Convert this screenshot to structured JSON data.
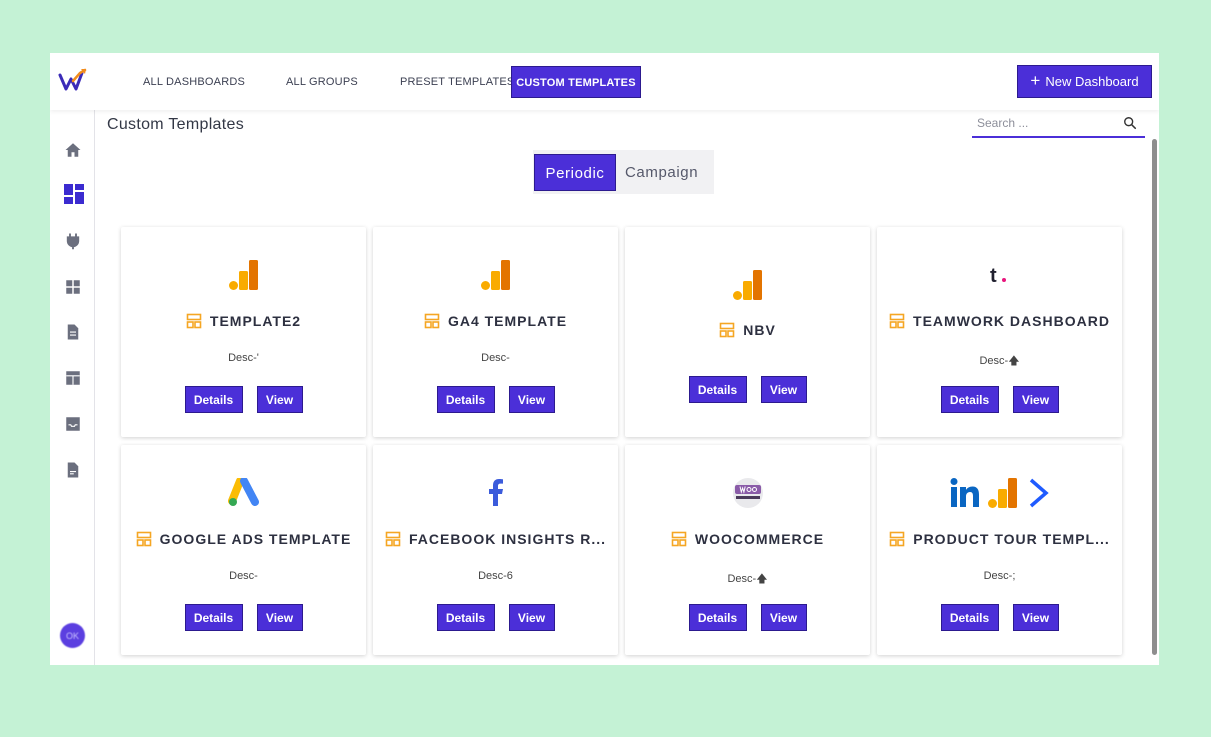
{
  "nav": {
    "tabs": [
      {
        "label": "ALL DASHBOARDS"
      },
      {
        "label": "ALL GROUPS"
      },
      {
        "label": "PRESET TEMPLATES"
      },
      {
        "label": "CUSTOM TEMPLATES"
      }
    ],
    "active_tab": "CUSTOM TEMPLATES",
    "new_dashboard_label": "New Dashboard"
  },
  "page": {
    "title": "Custom Templates",
    "search_placeholder": "Search ...",
    "toggle": {
      "periodic": "Periodic",
      "campaign": "Campaign",
      "selected": "Periodic"
    }
  },
  "sidebar": {
    "icons": [
      "home-icon",
      "dashboard-icon",
      "plug-icon",
      "widgets-icon",
      "document-icon",
      "table-icon",
      "inbox-icon",
      "file-icon"
    ],
    "active": "dashboard-icon",
    "avatar_text": "OK"
  },
  "cards": [
    {
      "title": "TEMPLATE2",
      "desc": "Desc-'",
      "logos": [
        "google-analytics-icon"
      ],
      "details": "Details",
      "view": "View"
    },
    {
      "title": "GA4 TEMPLATE",
      "desc": "Desc-",
      "logos": [
        "google-analytics-icon"
      ],
      "details": "Details",
      "view": "View"
    },
    {
      "title": "NBV",
      "desc": "",
      "logos": [
        "google-analytics-icon"
      ],
      "details": "Details",
      "view": "View"
    },
    {
      "title": "TEAMWORK DASHBOARD",
      "desc": "Desc-🡅",
      "logos": [
        "teamwork-icon"
      ],
      "details": "Details",
      "view": "View"
    },
    {
      "title": "GOOGLE ADS TEMPLATE",
      "desc": "Desc-",
      "logos": [
        "google-ads-icon"
      ],
      "details": "Details",
      "view": "View"
    },
    {
      "title": "FACEBOOK INSIGHTS R...",
      "desc": "Desc-6",
      "logos": [
        "facebook-icon"
      ],
      "details": "Details",
      "view": "View"
    },
    {
      "title": "WOOCOMMERCE",
      "desc": "Desc-🡅",
      "logos": [
        "woocommerce-icon"
      ],
      "details": "Details",
      "view": "View"
    },
    {
      "title": "PRODUCT TOUR TEMPL...",
      "desc": "Desc-;",
      "logos": [
        "linkedin-icon",
        "google-analytics-icon",
        "activecampaign-icon"
      ],
      "details": "Details",
      "view": "View"
    }
  ],
  "colors": {
    "accent": "#4b2fd8",
    "background": "#c4f2d5",
    "template_icon": "#f5a623"
  }
}
